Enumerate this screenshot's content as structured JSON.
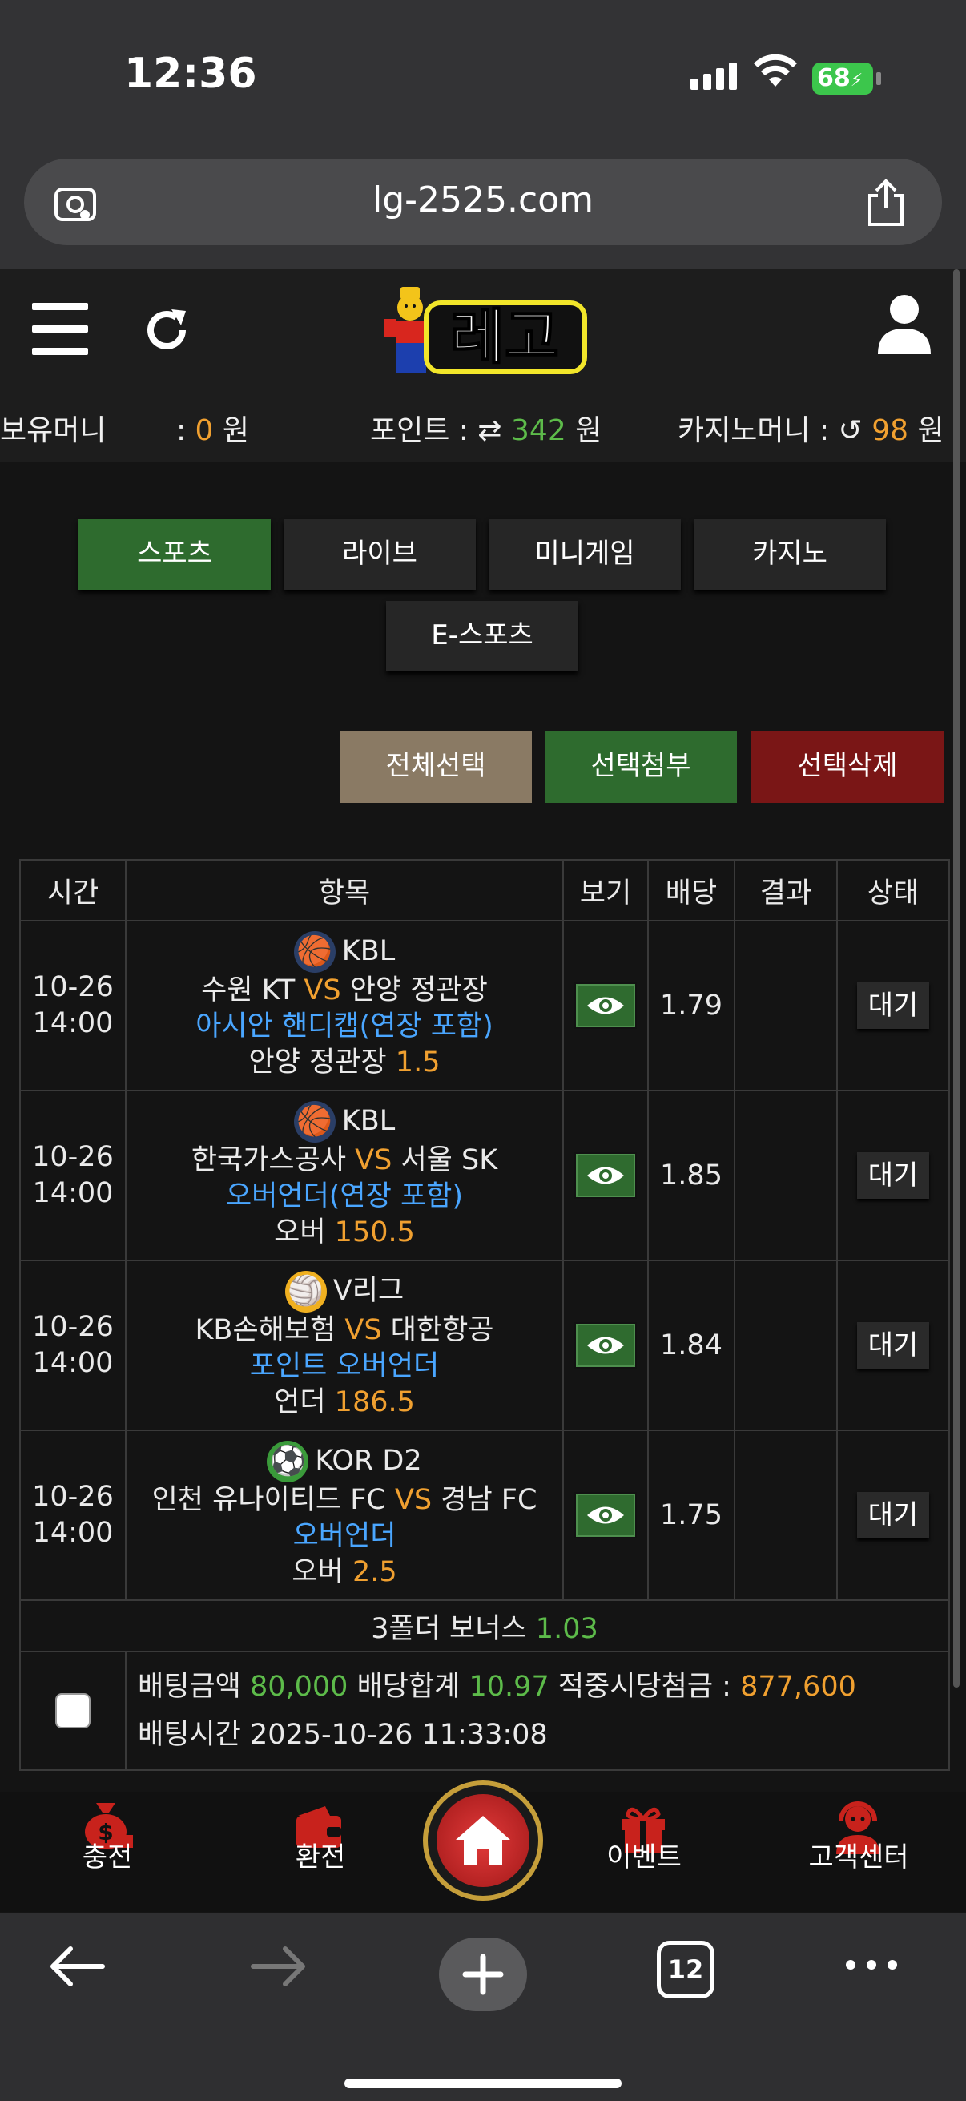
{
  "status_bar": {
    "time": "12:36",
    "battery": "68"
  },
  "browser": {
    "url": "lg-2525.com",
    "tab_count": "12"
  },
  "header": {
    "logo_text": "레고"
  },
  "balances": {
    "money_label": "보유머니",
    "money_sep": ":",
    "money_value": "0",
    "money_unit": "원",
    "point_label": "포인트 :",
    "point_value": "342",
    "point_unit": "원",
    "casino_label": "카지노머니 :",
    "casino_value": "98",
    "casino_unit": "원"
  },
  "tabs": [
    "스포츠",
    "라이브",
    "미니게임",
    "카지노",
    "E-스포츠"
  ],
  "actions": {
    "select_all": "전체선택",
    "attach": "선택첨부",
    "delete": "선택삭제"
  },
  "table": {
    "headers": [
      "시간",
      "항목",
      "보기",
      "배당",
      "결과",
      "상태"
    ],
    "rows": [
      {
        "date": "10-26",
        "time": "14:00",
        "league": "KBL",
        "home": "수원 KT",
        "vs": "VS",
        "away": "안양 정관장",
        "market": "아시안 핸디캡(연장 포함)",
        "pick": "안양 정관장",
        "pick_value": "1.5",
        "odds": "1.79",
        "result": "",
        "status": "대기"
      },
      {
        "date": "10-26",
        "time": "14:00",
        "league": "KBL",
        "home": "한국가스공사",
        "vs": "VS",
        "away": "서울 SK",
        "market": "오버언더(연장 포함)",
        "pick": "오버",
        "pick_value": "150.5",
        "odds": "1.85",
        "result": "",
        "status": "대기"
      },
      {
        "date": "10-26",
        "time": "14:00",
        "league": "V리그",
        "home": "KB손해보험",
        "vs": "VS",
        "away": "대한항공",
        "market": "포인트 오버언더",
        "pick": "언더",
        "pick_value": "186.5",
        "odds": "1.84",
        "result": "",
        "status": "대기"
      },
      {
        "date": "10-26",
        "time": "14:00",
        "league": "KOR D2",
        "home": "인천 유나이티드 FC",
        "vs": "VS",
        "away": "경남 FC",
        "market": "오버언더",
        "pick": "오버",
        "pick_value": "2.5",
        "odds": "1.75",
        "result": "",
        "status": "대기"
      }
    ],
    "bonus_label": "3폴더 보너스",
    "bonus_value": "1.03",
    "summary": {
      "bet_amount_label": "배팅금액",
      "bet_amount": "80,000",
      "odds_total_label": "배당합계",
      "odds_total": "10.97",
      "payout_label": "적중시당첨금 :",
      "payout": "877,600",
      "bet_time_label": "배팅시간",
      "bet_time": "2025-10-26 11:33:08"
    }
  },
  "bottom_nav": {
    "charge": "충전",
    "withdraw": "환전",
    "event": "이벤트",
    "support": "고객센터"
  },
  "colors": {
    "green": "#5dbb4a",
    "orange": "#f0a030",
    "blue": "#4aa6ff",
    "active_tab": "#2e6b2e",
    "delete_btn": "#7a1616"
  }
}
